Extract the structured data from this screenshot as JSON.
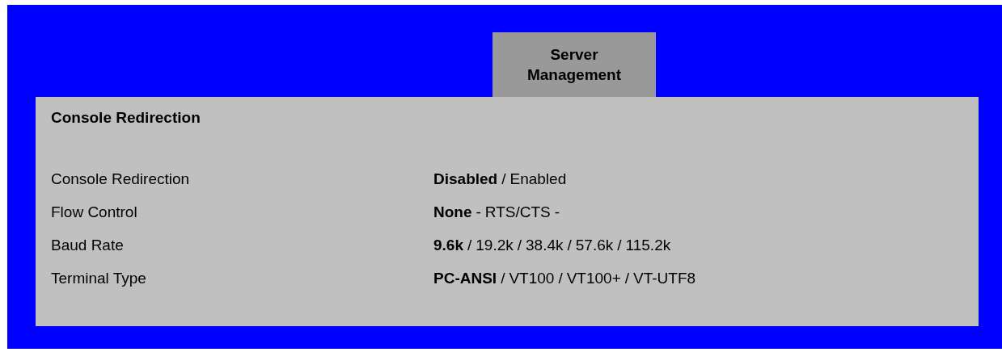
{
  "tabs": [
    {
      "label": "Server Management",
      "selected": true
    }
  ],
  "panel": {
    "title": "Console Redirection",
    "rows": [
      {
        "label": "Console Redirection",
        "separator": "/",
        "options": [
          {
            "label": "Disabled",
            "selected": true
          },
          {
            "label": "Enabled",
            "selected": false
          }
        ]
      },
      {
        "label": "Flow Control",
        "separator": "-",
        "trailing": "-",
        "options": [
          {
            "label": "None",
            "selected": true
          },
          {
            "label": "RTS/CTS",
            "selected": false
          }
        ]
      },
      {
        "label": "Baud Rate",
        "separator": "/",
        "options": [
          {
            "label": "9.6k",
            "selected": true
          },
          {
            "label": "19.2k",
            "selected": false
          },
          {
            "label": "38.4k",
            "selected": false
          },
          {
            "label": "57.6k",
            "selected": false
          },
          {
            "label": "115.2k",
            "selected": false
          }
        ]
      },
      {
        "label": "Terminal Type",
        "separator": "/",
        "options": [
          {
            "label": "PC-ANSI",
            "selected": true
          },
          {
            "label": "VT100",
            "selected": false
          },
          {
            "label": "VT100+",
            "selected": false
          },
          {
            "label": "VT-UTF8",
            "selected": false
          }
        ]
      }
    ]
  }
}
